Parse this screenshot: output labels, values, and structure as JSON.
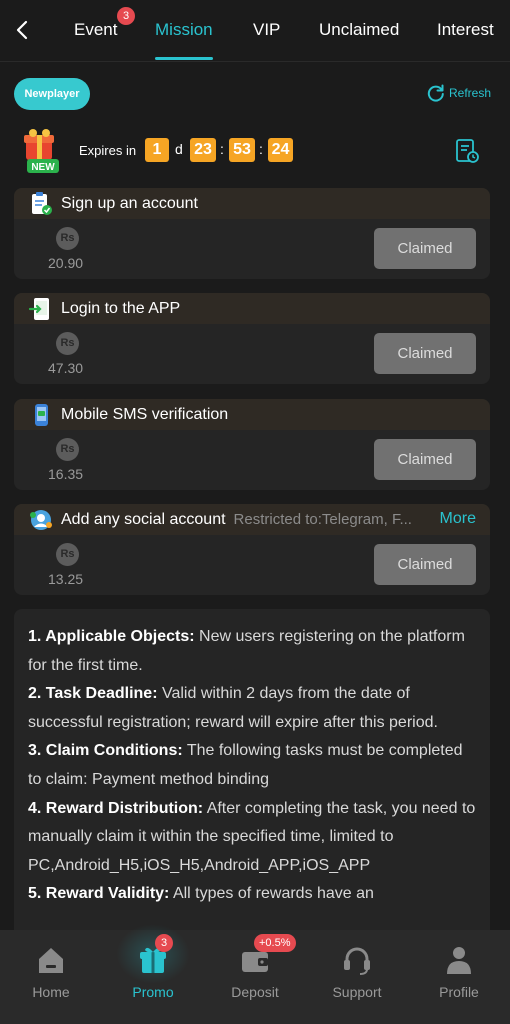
{
  "topnav": {
    "tabs": [
      {
        "label": "Event",
        "badge": "3"
      },
      {
        "label": "Mission"
      },
      {
        "label": "VIP"
      },
      {
        "label": "Unclaimed"
      },
      {
        "label": "Interest"
      }
    ],
    "active_tab": "Mission"
  },
  "header": {
    "pill_label": "Newplayer",
    "refresh_label": "Refresh",
    "gift_badge": "NEW",
    "expires_label": "Expires in",
    "timer": {
      "days": "1",
      "day_unit": "d",
      "hours": "23",
      "minutes": "53",
      "seconds": "24",
      "sep": ":"
    }
  },
  "tasks": [
    {
      "title": "Sign up an account",
      "currency": "Rs",
      "amount": "20.90",
      "button": "Claimed",
      "icon": "clipboard-check-icon"
    },
    {
      "title": "Login to the APP",
      "currency": "Rs",
      "amount": "47.30",
      "button": "Claimed",
      "icon": "app-login-icon"
    },
    {
      "title": "Mobile SMS verification",
      "currency": "Rs",
      "amount": "16.35",
      "button": "Claimed",
      "icon": "phone-sms-icon"
    },
    {
      "title": "Add any social account",
      "restriction": "Restricted to:Telegram, F...",
      "more": "More",
      "currency": "Rs",
      "amount": "13.25",
      "button": "Claimed",
      "icon": "social-account-icon"
    }
  ],
  "rules": [
    {
      "head": "1. Applicable Objects:",
      "text": " New users registering on the platform for the first time."
    },
    {
      "head": "2. Task Deadline:",
      "text": " Valid within 2 days from the date of successful registration; reward will expire after this period."
    },
    {
      "head": "3. Claim Conditions:",
      "text": " The following tasks must be completed to claim: Payment method binding"
    },
    {
      "head": "4. Reward Distribution:",
      "text": " After completing the task, you need to manually claim it within the specified time, limited to PC,Android_H5,iOS_H5,Android_APP,iOS_APP"
    },
    {
      "head": "5. Reward Validity:",
      "text": " All types of rewards have an"
    }
  ],
  "bottomnav": {
    "items": [
      {
        "label": "Home",
        "icon": "home-icon"
      },
      {
        "label": "Promo",
        "icon": "gift-icon",
        "badge": "3"
      },
      {
        "label": "Deposit",
        "icon": "wallet-icon",
        "badge": "+0.5%"
      },
      {
        "label": "Support",
        "icon": "headset-icon"
      },
      {
        "label": "Profile",
        "icon": "user-icon"
      }
    ],
    "active": "Promo"
  },
  "colors": {
    "accent": "#2ac3cf",
    "timer": "#f6a524",
    "badge": "#e64a50",
    "background": "#1b1b1b",
    "card": "#252525"
  }
}
